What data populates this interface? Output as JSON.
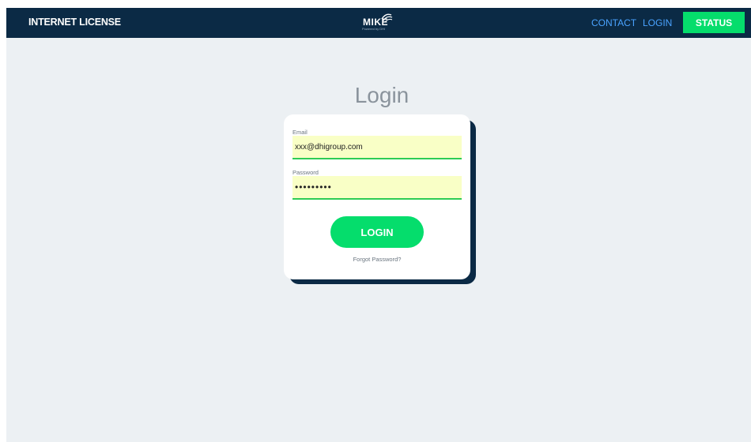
{
  "header": {
    "title": "INTERNET LICENSE",
    "logo": {
      "word": "MIKE",
      "tagline": "Powered by DHI"
    },
    "nav": {
      "contact_label": "CONTACT",
      "login_label": "LOGIN",
      "status_label": "STATUS"
    }
  },
  "login_form": {
    "heading": "Login",
    "email_label": "Email",
    "email_value": "xxx@dhigroup.com",
    "password_label": "Password",
    "password_value": "•••••••••",
    "submit_label": "LOGIN",
    "forgot_label": "Forgot Password?"
  },
  "colors": {
    "header_bg": "#0b2a45",
    "accent_green": "#05dd6c",
    "link_blue": "#4aa3ff",
    "autofill_yellow": "#f9ffc6",
    "page_bg": "#ecf0f3"
  },
  "icons": {
    "logo_mark": "mike-swirl-icon"
  }
}
